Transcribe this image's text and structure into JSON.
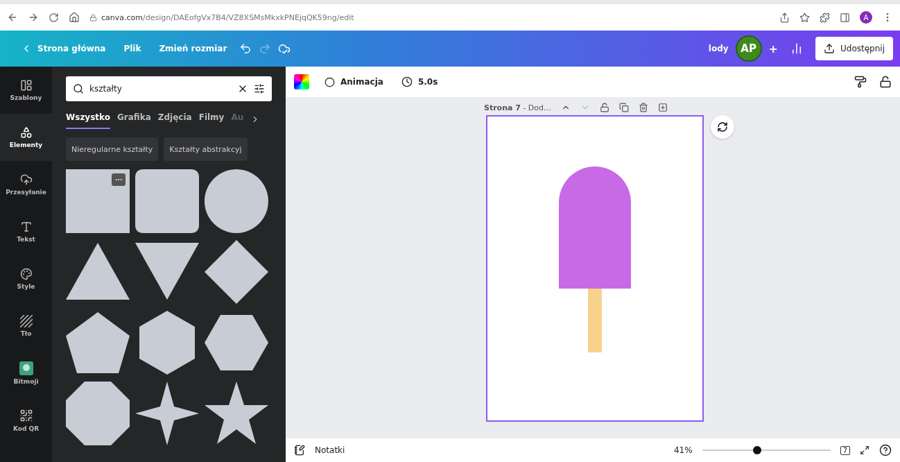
{
  "browser": {
    "url_host": "canva.com",
    "url_path": "/design/DAEofgVx7B4/VZ8XSMsMkxkPNEjqQK59ng/edit",
    "profile": "A"
  },
  "topbar": {
    "back": "Strona główna",
    "menu": [
      "Plik",
      "Zmień rozmiar"
    ],
    "design_name": "lody",
    "avatar": "AP",
    "plus": "+",
    "share": "Udostępnij"
  },
  "rail": [
    {
      "label": "Szablony",
      "kind": "layout",
      "selected": false
    },
    {
      "label": "Elementy",
      "kind": "shapes",
      "selected": true
    },
    {
      "label": "Przesyłanie",
      "kind": "upload",
      "selected": false
    },
    {
      "label": "Tekst",
      "kind": "text",
      "selected": false
    },
    {
      "label": "Style",
      "kind": "palette",
      "selected": false
    },
    {
      "label": "Tło",
      "kind": "hatch",
      "selected": false
    },
    {
      "label": "Bitmoji",
      "kind": "bitmoji",
      "selected": false
    },
    {
      "label": "Kod QR",
      "kind": "qr",
      "selected": false
    }
  ],
  "search": {
    "value": "kształty"
  },
  "tabs": [
    {
      "label": "Wszystko",
      "selected": true
    },
    {
      "label": "Grafika",
      "selected": false
    },
    {
      "label": "Zdjęcia",
      "selected": false
    },
    {
      "label": "Filmy",
      "selected": false
    },
    {
      "label": "Au",
      "selected": false
    }
  ],
  "chips": [
    "Nieregularne kształty",
    "Kształty abstrakcyj"
  ],
  "shapes": [
    {
      "kind": "square",
      "more": true
    },
    {
      "kind": "rounded",
      "more": false
    },
    {
      "kind": "circle",
      "more": false
    },
    {
      "kind": "triangle",
      "more": false
    },
    {
      "kind": "down-triangle",
      "more": false
    },
    {
      "kind": "diamond",
      "more": false
    },
    {
      "kind": "pentagon",
      "more": false
    },
    {
      "kind": "hexagon",
      "more": false
    },
    {
      "kind": "hexagon-flat",
      "more": false
    },
    {
      "kind": "octagon",
      "more": false
    },
    {
      "kind": "star4",
      "more": false
    },
    {
      "kind": "star5",
      "more": false
    }
  ],
  "toolbar": {
    "animation": "Animacja",
    "duration": "5.0s"
  },
  "page": {
    "title": "**Strona 7** - Dod…"
  },
  "footer": {
    "notes": "Notatki",
    "zoom": "41%",
    "level": 0.43,
    "page_count": "7"
  }
}
